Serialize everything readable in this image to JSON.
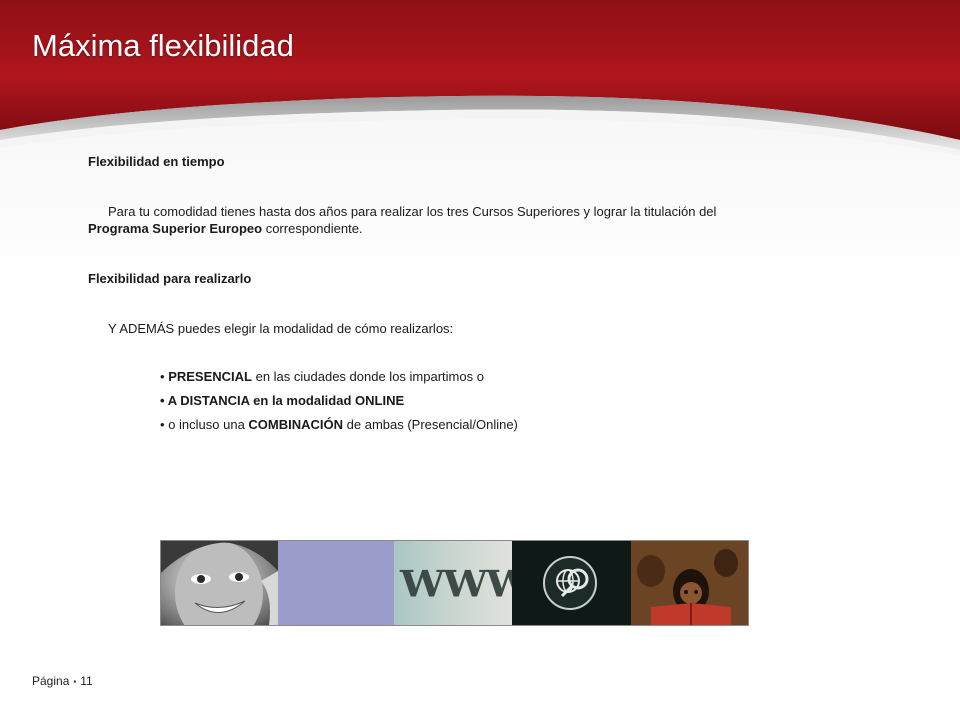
{
  "slide": {
    "title": "Máxima flexibilidad",
    "section1": {
      "heading": "Flexibilidad en tiempo",
      "text_before": "Para tu comodidad tienes hasta dos años para realizar los tres Cursos Superiores y lograr la titulación del ",
      "text_bold": "Programa Superior Europeo",
      "text_after": " correspondiente."
    },
    "section2": {
      "heading": "Flexibilidad para realizarlo",
      "intro": "Y ADEMÁS puedes elegir la modalidad de cómo realizarlos:"
    },
    "bullets": [
      {
        "marker": "•",
        "bold": "PRESENCIAL",
        "rest": " en las ciudades donde los impartimos o"
      },
      {
        "marker": "•",
        "bold": "A DISTANCIA en la modalidad ONLINE",
        "rest": ""
      },
      {
        "marker": "•",
        "pre": "o incluso una ",
        "bold": "COMBINACIÓN",
        "rest": " de ambas (Presencial/Online)"
      }
    ],
    "image_strip": {
      "www_text": "WWW"
    },
    "footer": {
      "label": "Página",
      "separator": "▪",
      "page_number": "11"
    }
  },
  "colors": {
    "header_red": "#a8141c",
    "header_dark_red": "#6e0a0e",
    "title_text": "#ffffff",
    "body_text": "#1a1a1a",
    "lavender_tile": "#9b9ccc"
  }
}
